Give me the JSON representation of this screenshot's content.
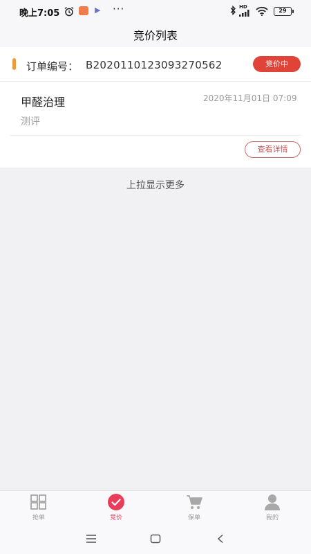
{
  "status_bar": {
    "time": "晚上7:05",
    "battery": "29",
    "network": "HD",
    "more": "···"
  },
  "header": {
    "title": "竞价列表"
  },
  "order": {
    "label": "订单编号：",
    "number": "B2020110123093270562",
    "status": "竞价中",
    "service_name": "甲醛治理",
    "date": "2020年11月01日 07:09",
    "service_type": "测评",
    "detail_button": "查看详情"
  },
  "list": {
    "load_more": "上拉显示更多"
  },
  "tab_bar": {
    "items": [
      {
        "label": "抢单",
        "icon": "grid-icon",
        "active": false
      },
      {
        "label": "竞价",
        "icon": "check-circle-icon",
        "active": true
      },
      {
        "label": "保单",
        "icon": "cart-icon",
        "active": false
      },
      {
        "label": "我的",
        "icon": "user-icon",
        "active": false
      }
    ]
  },
  "colors": {
    "accent": "#e83e5c",
    "badge": "#e04438",
    "order_marker": "#ec9a3a"
  }
}
